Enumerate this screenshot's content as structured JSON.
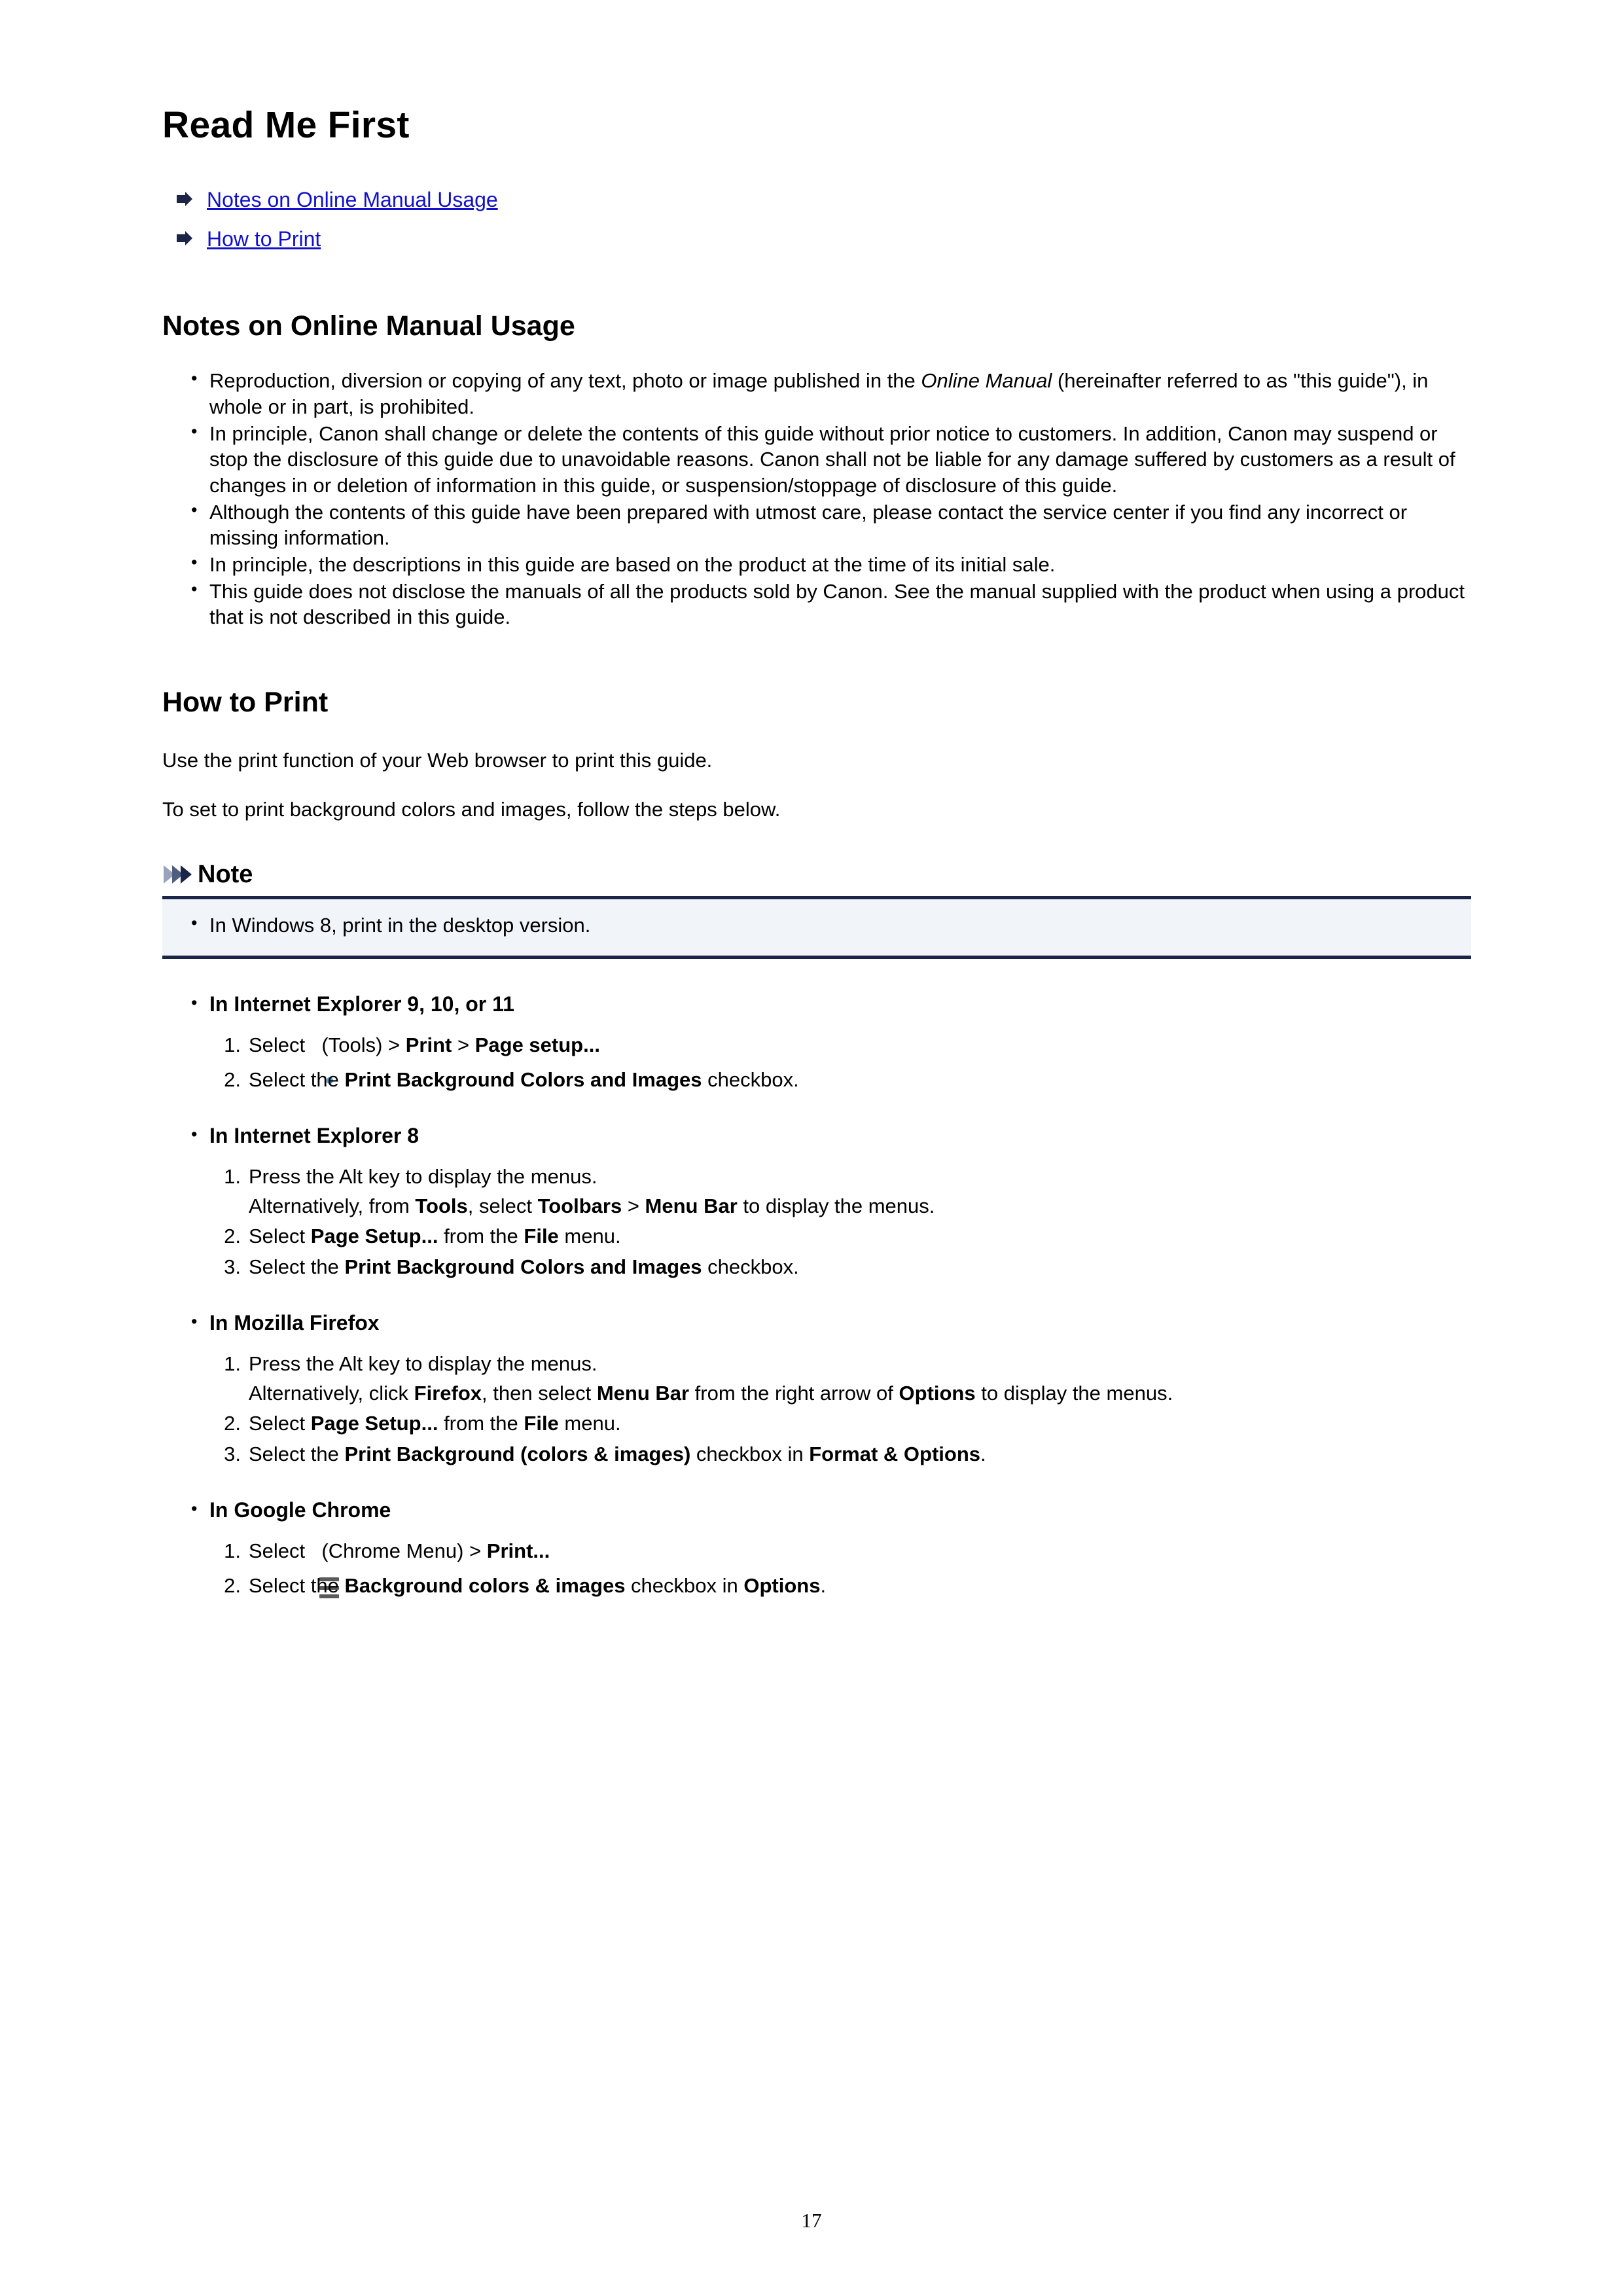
{
  "document": {
    "title": "Read Me First",
    "page_number": "17"
  },
  "toc": {
    "arrow_icon": "arrow-right-icon",
    "links": [
      {
        "label": "Notes on Online Manual Usage"
      },
      {
        "label": "How to Print"
      }
    ]
  },
  "notes_section": {
    "heading": "Notes on Online Manual Usage",
    "bullets": [
      {
        "parts": [
          {
            "text": "Reproduction, diversion or copying of any text, photo or image published in the ",
            "style": "normal"
          },
          {
            "text": "Online Manual",
            "style": "italic"
          },
          {
            "text": " (hereinafter referred to as \"this guide\"), in whole or in part, is prohibited.",
            "style": "normal"
          }
        ]
      },
      {
        "parts": [
          {
            "text": "In principle, Canon shall change or delete the contents of this guide without prior notice to customers. In addition, Canon may suspend or stop the disclosure of this guide due to unavoidable reasons. Canon shall not be liable for any damage suffered by customers as a result of changes in or deletion of information in this guide, or suspension/stoppage of disclosure of this guide.",
            "style": "normal"
          }
        ]
      },
      {
        "parts": [
          {
            "text": "Although the contents of this guide have been prepared with utmost care, please contact the service center if you find any incorrect or missing information.",
            "style": "normal"
          }
        ]
      },
      {
        "parts": [
          {
            "text": "In principle, the descriptions in this guide are based on the product at the time of its initial sale.",
            "style": "normal"
          }
        ]
      },
      {
        "parts": [
          {
            "text": "This guide does not disclose the manuals of all the products sold by Canon. See the manual supplied with the product when using a product that is not described in this guide.",
            "style": "normal"
          }
        ]
      }
    ]
  },
  "print_section": {
    "heading": "How to Print",
    "intro_paragraph_1": "Use the print function of your Web browser to print this guide.",
    "intro_paragraph_2": "To set to print background colors and images, follow the steps below.",
    "note": {
      "title": "Note",
      "chevron_icon": "chevron-triple-icon",
      "bullets": [
        "In Windows 8, print in the desktop version."
      ]
    },
    "browsers": [
      {
        "name": "In Internet Explorer 9, 10, or 11",
        "steps": [
          {
            "parts": [
              {
                "text": "Select ",
                "style": "normal"
              },
              {
                "icon": "gear-icon"
              },
              {
                "text": " (Tools) > ",
                "style": "normal"
              },
              {
                "text": "Print",
                "style": "bold"
              },
              {
                "text": " > ",
                "style": "normal"
              },
              {
                "text": "Page setup...",
                "style": "bold"
              }
            ]
          },
          {
            "parts": [
              {
                "text": "Select the ",
                "style": "normal"
              },
              {
                "text": "Print Background Colors and Images",
                "style": "bold"
              },
              {
                "text": " checkbox.",
                "style": "normal"
              }
            ]
          }
        ]
      },
      {
        "name": "In Internet Explorer 8",
        "steps": [
          {
            "parts": [
              {
                "text": "Press the Alt key to display the menus.",
                "style": "normal"
              }
            ],
            "alt_parts": [
              {
                "text": "Alternatively, from ",
                "style": "normal"
              },
              {
                "text": "Tools",
                "style": "bold"
              },
              {
                "text": ", select ",
                "style": "normal"
              },
              {
                "text": "Toolbars",
                "style": "bold"
              },
              {
                "text": " > ",
                "style": "normal"
              },
              {
                "text": "Menu Bar",
                "style": "bold"
              },
              {
                "text": " to display the menus.",
                "style": "normal"
              }
            ]
          },
          {
            "parts": [
              {
                "text": "Select ",
                "style": "normal"
              },
              {
                "text": "Page Setup...",
                "style": "bold"
              },
              {
                "text": " from the ",
                "style": "normal"
              },
              {
                "text": "File",
                "style": "bold"
              },
              {
                "text": " menu.",
                "style": "normal"
              }
            ]
          },
          {
            "parts": [
              {
                "text": "Select the ",
                "style": "normal"
              },
              {
                "text": "Print Background Colors and Images",
                "style": "bold"
              },
              {
                "text": " checkbox.",
                "style": "normal"
              }
            ]
          }
        ]
      },
      {
        "name": "In Mozilla Firefox",
        "steps": [
          {
            "parts": [
              {
                "text": "Press the Alt key to display the menus.",
                "style": "normal"
              }
            ],
            "alt_parts": [
              {
                "text": "Alternatively, click ",
                "style": "normal"
              },
              {
                "text": "Firefox",
                "style": "bold"
              },
              {
                "text": ", then select ",
                "style": "normal"
              },
              {
                "text": "Menu Bar",
                "style": "bold"
              },
              {
                "text": " from the right arrow of ",
                "style": "normal"
              },
              {
                "text": "Options",
                "style": "bold"
              },
              {
                "text": " to display the menus.",
                "style": "normal"
              }
            ]
          },
          {
            "parts": [
              {
                "text": "Select ",
                "style": "normal"
              },
              {
                "text": "Page Setup...",
                "style": "bold"
              },
              {
                "text": " from the ",
                "style": "normal"
              },
              {
                "text": "File",
                "style": "bold"
              },
              {
                "text": " menu.",
                "style": "normal"
              }
            ]
          },
          {
            "parts": [
              {
                "text": "Select the ",
                "style": "normal"
              },
              {
                "text": "Print Background (colors & images)",
                "style": "bold"
              },
              {
                "text": " checkbox in ",
                "style": "normal"
              },
              {
                "text": "Format & Options",
                "style": "bold"
              },
              {
                "text": ".",
                "style": "normal"
              }
            ]
          }
        ]
      },
      {
        "name": "In Google Chrome",
        "steps": [
          {
            "parts": [
              {
                "text": "Select ",
                "style": "normal"
              },
              {
                "icon": "hamburger-menu-icon"
              },
              {
                "text": " (Chrome Menu) > ",
                "style": "normal"
              },
              {
                "text": "Print...",
                "style": "bold"
              }
            ]
          },
          {
            "parts": [
              {
                "text": "Select the ",
                "style": "normal"
              },
              {
                "text": "Background colors & images",
                "style": "bold"
              },
              {
                "text": " checkbox in ",
                "style": "normal"
              },
              {
                "text": "Options",
                "style": "bold"
              },
              {
                "text": ".",
                "style": "normal"
              }
            ]
          }
        ]
      }
    ]
  },
  "colors": {
    "link": "#1111cc",
    "note_accent": "#1b2547",
    "note_background": "#f1f4f9",
    "gear_chip": "#5ba3de",
    "hamburger_chip": "#ededed"
  }
}
